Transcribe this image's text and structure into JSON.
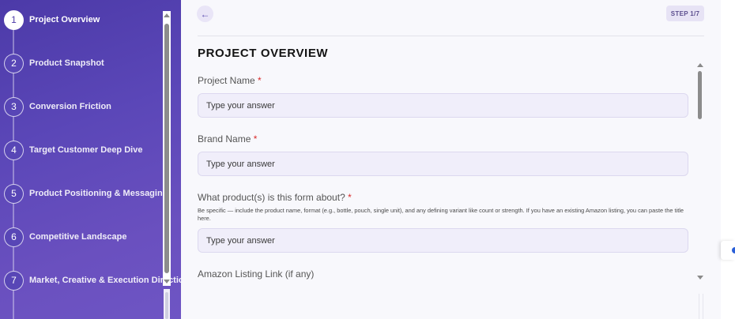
{
  "sidebar": {
    "steps": [
      {
        "number": "1",
        "label": "Project Overview"
      },
      {
        "number": "2",
        "label": "Product Snapshot"
      },
      {
        "number": "3",
        "label": "Conversion Friction"
      },
      {
        "number": "4",
        "label": "Target Customer Deep Dive"
      },
      {
        "number": "5",
        "label": "Product Positioning & Messaging"
      },
      {
        "number": "6",
        "label": "Competitive Landscape"
      },
      {
        "number": "7",
        "label": "Market, Creative & Execution Direction"
      }
    ],
    "active_step": 1
  },
  "header": {
    "back_icon": "←",
    "step_badge": "STEP 1/7"
  },
  "form": {
    "title": "PROJECT OVERVIEW",
    "required_mark": "*",
    "fields": [
      {
        "label": "Project Name",
        "required": true,
        "placeholder": "Type your answer"
      },
      {
        "label": "Brand Name",
        "required": true,
        "placeholder": "Type your answer"
      },
      {
        "label": "What product(s) is this form about?",
        "required": true,
        "help": "Be specific — include the product name, format (e.g., bottle, pouch, single unit), and any defining variant like count or strength. If you have an existing Amazon listing, you can paste the title here.",
        "placeholder": "Type your answer"
      },
      {
        "label": "Amazon Listing Link (if any)",
        "required": false
      }
    ]
  },
  "colors": {
    "sidebar_gradient_start": "#4c3aa8",
    "sidebar_gradient_end": "#6e55c4",
    "required": "#d92b2b",
    "input_bg": "#f0eefa"
  }
}
